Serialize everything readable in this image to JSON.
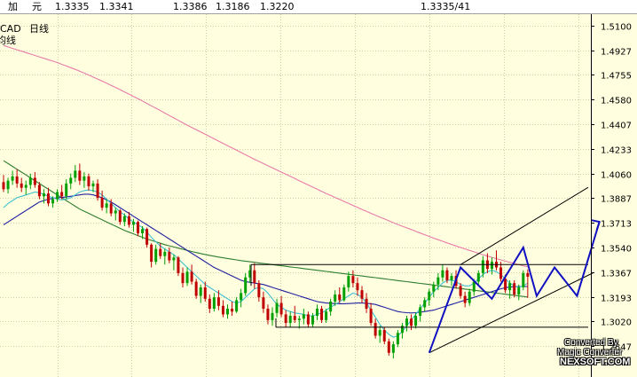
{
  "header": {
    "frag1": "加",
    "frag2": "元",
    "quote1": "1.3335",
    "quote2": "1.3341",
    "quote3": "1.3386",
    "quote4": "1.3186",
    "quote5": "1.3220",
    "quote6": "1.3335/41"
  },
  "symbol_label": "CAD",
  "period_label": "日线",
  "ma_label": "均线",
  "watermark": {
    "line1": "Converted By",
    "line2": "Magic Converter",
    "line3": "NEXSOFT.COM"
  },
  "colors": {
    "background": "#ffffe0",
    "bull_candle": "#00a000",
    "bear_candle": "#c00000",
    "ma_long": "#e87aa8",
    "ma_mid": "#2e7d32",
    "ma_short": "#2020a0",
    "ma_fast": "#40c0d0",
    "trend_lines": "#000000",
    "pattern_lines": "#1010c0"
  },
  "chart_data": {
    "type": "candlestick",
    "title": "",
    "xlabel": "",
    "ylabel": "",
    "ylim": [
      1.263,
      1.518
    ],
    "y_ticks": [
      "1.5100",
      "1.4927",
      "1.4755",
      "1.4580",
      "1.4407",
      "1.4233",
      "1.4060",
      "1.3887",
      "1.3713",
      "1.3540",
      "1.3367",
      "1.3193",
      "1.3020",
      "1.2847"
    ],
    "grid": true,
    "candles": [
      [
        1.4,
        1.405,
        1.393,
        1.395
      ],
      [
        1.395,
        1.403,
        1.392,
        1.401
      ],
      [
        1.401,
        1.408,
        1.398,
        1.404
      ],
      [
        1.404,
        1.409,
        1.396,
        1.399
      ],
      [
        1.399,
        1.403,
        1.393,
        1.396
      ],
      [
        1.396,
        1.401,
        1.391,
        1.398
      ],
      [
        1.398,
        1.406,
        1.395,
        1.403
      ],
      [
        1.403,
        1.407,
        1.396,
        1.398
      ],
      [
        1.398,
        1.4,
        1.388,
        1.39
      ],
      [
        1.39,
        1.395,
        1.385,
        1.392
      ],
      [
        1.392,
        1.396,
        1.383,
        1.385
      ],
      [
        1.385,
        1.39,
        1.382,
        1.388
      ],
      [
        1.388,
        1.395,
        1.386,
        1.393
      ],
      [
        1.393,
        1.398,
        1.388,
        1.39
      ],
      [
        1.39,
        1.402,
        1.388,
        1.399
      ],
      [
        1.399,
        1.406,
        1.395,
        1.403
      ],
      [
        1.403,
        1.412,
        1.4,
        1.408
      ],
      [
        1.408,
        1.413,
        1.398,
        1.401
      ],
      [
        1.401,
        1.407,
        1.396,
        1.404
      ],
      [
        1.404,
        1.406,
        1.394,
        1.397
      ],
      [
        1.397,
        1.401,
        1.393,
        1.399
      ],
      [
        1.399,
        1.402,
        1.387,
        1.389
      ],
      [
        1.389,
        1.394,
        1.38,
        1.382
      ],
      [
        1.382,
        1.388,
        1.378,
        1.385
      ],
      [
        1.385,
        1.388,
        1.376,
        1.378
      ],
      [
        1.378,
        1.382,
        1.373,
        1.38
      ],
      [
        1.38,
        1.381,
        1.37,
        1.372
      ],
      [
        1.372,
        1.378,
        1.369,
        1.376
      ],
      [
        1.376,
        1.379,
        1.368,
        1.37
      ],
      [
        1.37,
        1.374,
        1.365,
        1.372
      ],
      [
        1.372,
        1.373,
        1.362,
        1.364
      ],
      [
        1.364,
        1.369,
        1.36,
        1.367
      ],
      [
        1.367,
        1.368,
        1.354,
        1.356
      ],
      [
        1.356,
        1.357,
        1.34,
        1.344
      ],
      [
        1.344,
        1.356,
        1.342,
        1.353
      ],
      [
        1.353,
        1.357,
        1.346,
        1.348
      ],
      [
        1.348,
        1.353,
        1.342,
        1.351
      ],
      [
        1.351,
        1.354,
        1.343,
        1.345
      ],
      [
        1.345,
        1.349,
        1.338,
        1.347
      ],
      [
        1.347,
        1.348,
        1.334,
        1.336
      ],
      [
        1.336,
        1.34,
        1.326,
        1.329
      ],
      [
        1.329,
        1.34,
        1.327,
        1.337
      ],
      [
        1.337,
        1.342,
        1.328,
        1.33
      ],
      [
        1.33,
        1.332,
        1.318,
        1.32
      ],
      [
        1.32,
        1.328,
        1.315,
        1.326
      ],
      [
        1.326,
        1.33,
        1.316,
        1.318
      ],
      [
        1.318,
        1.321,
        1.308,
        1.311
      ],
      [
        1.311,
        1.322,
        1.309,
        1.319
      ],
      [
        1.319,
        1.324,
        1.31,
        1.313
      ],
      [
        1.313,
        1.317,
        1.305,
        1.307
      ],
      [
        1.307,
        1.314,
        1.304,
        1.311
      ],
      [
        1.311,
        1.316,
        1.306,
        1.309
      ],
      [
        1.309,
        1.319,
        1.308,
        1.317
      ],
      [
        1.317,
        1.325,
        1.312,
        1.322
      ],
      [
        1.322,
        1.336,
        1.32,
        1.333
      ],
      [
        1.333,
        1.342,
        1.329,
        1.338
      ],
      [
        1.338,
        1.343,
        1.325,
        1.329
      ],
      [
        1.329,
        1.331,
        1.316,
        1.319
      ],
      [
        1.319,
        1.323,
        1.308,
        1.311
      ],
      [
        1.311,
        1.314,
        1.3,
        1.303
      ],
      [
        1.303,
        1.312,
        1.299,
        1.308
      ],
      [
        1.308,
        1.318,
        1.305,
        1.315
      ],
      [
        1.315,
        1.32,
        1.305,
        1.307
      ],
      [
        1.307,
        1.31,
        1.298,
        1.301
      ],
      [
        1.301,
        1.309,
        1.298,
        1.306
      ],
      [
        1.306,
        1.313,
        1.301,
        1.303
      ],
      [
        1.303,
        1.306,
        1.297,
        1.304
      ],
      [
        1.304,
        1.311,
        1.3,
        1.307
      ],
      [
        1.307,
        1.309,
        1.298,
        1.3
      ],
      [
        1.3,
        1.308,
        1.298,
        1.306
      ],
      [
        1.306,
        1.314,
        1.303,
        1.311
      ],
      [
        1.311,
        1.313,
        1.301,
        1.303
      ],
      [
        1.303,
        1.311,
        1.301,
        1.309
      ],
      [
        1.309,
        1.318,
        1.306,
        1.316
      ],
      [
        1.316,
        1.324,
        1.313,
        1.321
      ],
      [
        1.321,
        1.326,
        1.315,
        1.317
      ],
      [
        1.317,
        1.328,
        1.316,
        1.326
      ],
      [
        1.326,
        1.337,
        1.323,
        1.334
      ],
      [
        1.334,
        1.338,
        1.326,
        1.329
      ],
      [
        1.329,
        1.333,
        1.32,
        1.324
      ],
      [
        1.324,
        1.327,
        1.315,
        1.318
      ],
      [
        1.318,
        1.322,
        1.308,
        1.311
      ],
      [
        1.311,
        1.315,
        1.299,
        1.301
      ],
      [
        1.301,
        1.304,
        1.29,
        1.292
      ],
      [
        1.292,
        1.299,
        1.287,
        1.296
      ],
      [
        1.296,
        1.298,
        1.286,
        1.288
      ],
      [
        1.288,
        1.29,
        1.278,
        1.28
      ],
      [
        1.28,
        1.288,
        1.276,
        1.286
      ],
      [
        1.286,
        1.296,
        1.284,
        1.294
      ],
      [
        1.294,
        1.301,
        1.29,
        1.299
      ],
      [
        1.299,
        1.306,
        1.295,
        1.304
      ],
      [
        1.304,
        1.307,
        1.296,
        1.299
      ],
      [
        1.299,
        1.308,
        1.297,
        1.306
      ],
      [
        1.306,
        1.314,
        1.302,
        1.312
      ],
      [
        1.312,
        1.319,
        1.309,
        1.317
      ],
      [
        1.317,
        1.325,
        1.313,
        1.323
      ],
      [
        1.323,
        1.33,
        1.319,
        1.328
      ],
      [
        1.328,
        1.336,
        1.324,
        1.333
      ],
      [
        1.333,
        1.342,
        1.33,
        1.338
      ],
      [
        1.338,
        1.34,
        1.329,
        1.331
      ],
      [
        1.331,
        1.336,
        1.327,
        1.334
      ],
      [
        1.334,
        1.338,
        1.325,
        1.327
      ],
      [
        1.327,
        1.329,
        1.318,
        1.32
      ],
      [
        1.32,
        1.323,
        1.312,
        1.315
      ],
      [
        1.315,
        1.325,
        1.313,
        1.323
      ],
      [
        1.323,
        1.332,
        1.32,
        1.33
      ],
      [
        1.33,
        1.338,
        1.327,
        1.336
      ],
      [
        1.336,
        1.348,
        1.333,
        1.345
      ],
      [
        1.345,
        1.35,
        1.336,
        1.339
      ],
      [
        1.339,
        1.347,
        1.335,
        1.344
      ],
      [
        1.344,
        1.352,
        1.338,
        1.34
      ],
      [
        1.34,
        1.344,
        1.33,
        1.332
      ],
      [
        1.332,
        1.335,
        1.322,
        1.324
      ],
      [
        1.324,
        1.331,
        1.318,
        1.329
      ],
      [
        1.329,
        1.331,
        1.319,
        1.321
      ],
      [
        1.321,
        1.328,
        1.317,
        1.326
      ],
      [
        1.326,
        1.338,
        1.324,
        1.336
      ],
      [
        1.336,
        1.3386,
        1.3186,
        1.3335
      ]
    ],
    "ma_fast": [
      1.382,
      1.385,
      1.387,
      1.389,
      1.39,
      1.391,
      1.392,
      1.393,
      1.3925,
      1.3915,
      1.39,
      1.389,
      1.388,
      1.3875,
      1.388,
      1.389,
      1.391,
      1.393,
      1.394,
      1.3945,
      1.394,
      1.393,
      1.391,
      1.388,
      1.385,
      1.382,
      1.379,
      1.377,
      1.374,
      1.372,
      1.37,
      1.368,
      1.365,
      1.361,
      1.358,
      1.355,
      1.353,
      1.351,
      1.349,
      1.346,
      1.343,
      1.34,
      1.337,
      1.334,
      1.331,
      1.328,
      1.326,
      1.324,
      1.322,
      1.32,
      1.318,
      1.316,
      1.315,
      1.316,
      1.319,
      1.322,
      1.325,
      1.326,
      1.325,
      1.322,
      1.318,
      1.314,
      1.312,
      1.31,
      1.309,
      1.308,
      1.3075,
      1.307,
      1.306,
      1.306,
      1.307,
      1.308,
      1.31,
      1.312,
      1.314,
      1.316,
      1.318,
      1.32,
      1.322,
      1.321,
      1.319,
      1.315,
      1.31,
      1.305,
      1.3,
      1.296,
      1.293,
      1.291,
      1.292,
      1.295,
      1.299,
      1.303,
      1.307,
      1.311,
      1.315,
      1.319,
      1.323,
      1.326,
      1.329,
      1.331,
      1.331,
      1.33,
      1.328,
      1.327,
      1.327,
      1.329,
      1.332,
      1.335,
      1.337,
      1.338,
      1.337,
      1.335,
      1.332,
      1.329,
      1.327,
      1.326,
      1.327,
      1.329
    ],
    "ma_short": [
      1.37,
      1.372,
      1.374,
      1.376,
      1.378,
      1.38,
      1.382,
      1.384,
      1.386,
      1.387,
      1.388,
      1.3885,
      1.389,
      1.3892,
      1.3895,
      1.39,
      1.3905,
      1.391,
      1.3915,
      1.3915,
      1.391,
      1.39,
      1.389,
      1.3875,
      1.386,
      1.384,
      1.382,
      1.38,
      1.378,
      1.376,
      1.374,
      1.372,
      1.37,
      1.368,
      1.366,
      1.364,
      1.362,
      1.36,
      1.358,
      1.356,
      1.354,
      1.352,
      1.35,
      1.348,
      1.346,
      1.344,
      1.342,
      1.34,
      1.3385,
      1.337,
      1.3355,
      1.334,
      1.3325,
      1.331,
      1.33,
      1.3295,
      1.329,
      1.3285,
      1.328,
      1.327,
      1.326,
      1.325,
      1.324,
      1.323,
      1.322,
      1.321,
      1.32,
      1.319,
      1.318,
      1.317,
      1.316,
      1.3155,
      1.315,
      1.3148,
      1.3146,
      1.3145,
      1.3145,
      1.3146,
      1.3148,
      1.315,
      1.315,
      1.3148,
      1.3145,
      1.314,
      1.313,
      1.312,
      1.311,
      1.31,
      1.309,
      1.3085,
      1.3082,
      1.308,
      1.3082,
      1.3085,
      1.309,
      1.3095,
      1.31,
      1.311,
      1.312,
      1.313,
      1.314,
      1.315,
      1.316,
      1.317,
      1.318,
      1.319,
      1.32,
      1.321,
      1.322,
      1.323,
      1.324,
      1.325,
      1.3258,
      1.3262,
      1.3265,
      1.3266,
      1.3266,
      1.3266
    ],
    "ma_mid": [
      1.415,
      1.413,
      1.411,
      1.409,
      1.407,
      1.405,
      1.403,
      1.401,
      1.399,
      1.397,
      1.395,
      1.393,
      1.391,
      1.389,
      1.387,
      1.385,
      1.383,
      1.381,
      1.3795,
      1.378,
      1.3765,
      1.375,
      1.3735,
      1.372,
      1.3705,
      1.369,
      1.3675,
      1.366,
      1.3648,
      1.3636,
      1.3624,
      1.3612,
      1.36,
      1.359,
      1.358,
      1.357,
      1.356,
      1.3552,
      1.3544,
      1.3536,
      1.3528,
      1.352,
      1.3512,
      1.3505,
      1.3498,
      1.3491,
      1.3485,
      1.3479,
      1.3473,
      1.3468,
      1.3463,
      1.3458,
      1.3453,
      1.3448,
      1.3444,
      1.344,
      1.3436,
      1.3432,
      1.3428,
      1.3424,
      1.342,
      1.3416,
      1.3412,
      1.3408,
      1.3404,
      1.34,
      1.3396,
      1.3392,
      1.3388,
      1.3384,
      1.338,
      1.3376,
      1.3372,
      1.3368,
      1.3364,
      1.336,
      1.3356,
      1.3352,
      1.3348,
      1.3344,
      1.334,
      1.3336,
      1.3332,
      1.3328,
      1.3324,
      1.332,
      1.3316,
      1.3312,
      1.3308,
      1.3304,
      1.33,
      1.3296,
      1.3292,
      1.3288,
      1.3284,
      1.328,
      1.3276,
      1.3272,
      1.3268,
      1.3264,
      1.326,
      1.3256,
      1.3252,
      1.3248,
      1.3244,
      1.324,
      1.3236,
      1.3232,
      1.3228,
      1.3224,
      1.322,
      1.3216,
      1.3212,
      1.3208,
      1.3204,
      1.32,
      1.3196,
      1.3192
    ],
    "ma_long": [
      1.496,
      1.495,
      1.494,
      1.493,
      1.492,
      1.491,
      1.49,
      1.489,
      1.488,
      1.487,
      1.486,
      1.485,
      1.484,
      1.4828,
      1.4816,
      1.4804,
      1.4792,
      1.478,
      1.4766,
      1.4752,
      1.4738,
      1.4724,
      1.471,
      1.4695,
      1.468,
      1.4665,
      1.465,
      1.4634,
      1.4618,
      1.4602,
      1.4586,
      1.457,
      1.4553,
      1.4536,
      1.4519,
      1.4502,
      1.4485,
      1.4468,
      1.4451,
      1.4434,
      1.4417,
      1.44,
      1.4384,
      1.4368,
      1.4352,
      1.4336,
      1.432,
      1.4304,
      1.4288,
      1.4272,
      1.4256,
      1.424,
      1.4224,
      1.4208,
      1.4192,
      1.4176,
      1.416,
      1.4145,
      1.413,
      1.4115,
      1.41,
      1.4085,
      1.407,
      1.4055,
      1.404,
      1.4025,
      1.401,
      1.3995,
      1.398,
      1.3965,
      1.395,
      1.3935,
      1.392,
      1.3906,
      1.3892,
      1.3878,
      1.3864,
      1.385,
      1.3836,
      1.3822,
      1.3808,
      1.3794,
      1.378,
      1.3767,
      1.3754,
      1.3741,
      1.3728,
      1.3715,
      1.3702,
      1.369,
      1.3678,
      1.3666,
      1.3654,
      1.3642,
      1.363,
      1.3618,
      1.3606,
      1.3595,
      1.3584,
      1.3573,
      1.3562,
      1.3551,
      1.354,
      1.353,
      1.352,
      1.351,
      1.35,
      1.349,
      1.348,
      1.3471,
      1.3462,
      1.3453,
      1.3444,
      1.3436,
      1.3428,
      1.342,
      1.3412,
      1.3404
    ],
    "range_box_top": 1.342,
    "range_box_bottom": 1.298,
    "channel_lower": [
      [
        95,
        1.28
      ],
      [
        123,
        1.323
      ]
    ],
    "channel_upper": [
      [
        102,
        1.342
      ],
      [
        123,
        1.382
      ]
    ],
    "pattern_legs": [
      [
        95,
        1.28
      ],
      [
        102,
        1.34
      ],
      [
        109,
        1.318
      ],
      [
        116,
        1.354
      ],
      [
        119,
        1.32
      ],
      [
        123,
        1.34
      ],
      [
        128,
        1.32
      ],
      [
        133,
        1.372
      ]
    ]
  }
}
